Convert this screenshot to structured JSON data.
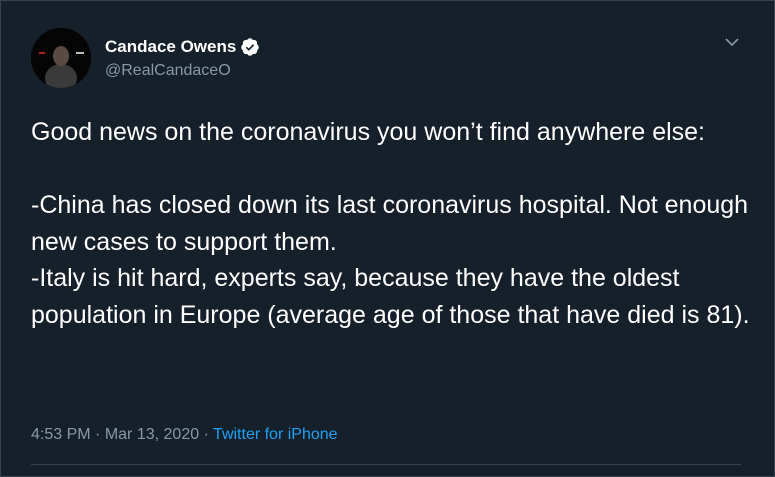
{
  "tweet": {
    "author_name": "Candace Owens",
    "author_handle": "@RealCandaceO",
    "verified": true,
    "text_paragraphs": [
      "Good news on the coronavirus you won’t find anywhere else:",
      "",
      "-China has closed down its last coronavirus hospital. Not enough new cases to support them.",
      "-Italy is hit hard, experts say, because they have the oldest population in Europe (average age of those that have died is 81)."
    ],
    "time": "4:53 PM",
    "separator": "·",
    "date": "Mar 13, 2020",
    "source": "Twitter for iPhone"
  },
  "icons": {
    "verified": "verified-badge-icon",
    "menu": "chevron-down-icon"
  },
  "colors": {
    "background": "#15202b",
    "text": "#ffffff",
    "secondary_text": "#8899a6",
    "link": "#1da1f2",
    "border": "#38444d"
  }
}
